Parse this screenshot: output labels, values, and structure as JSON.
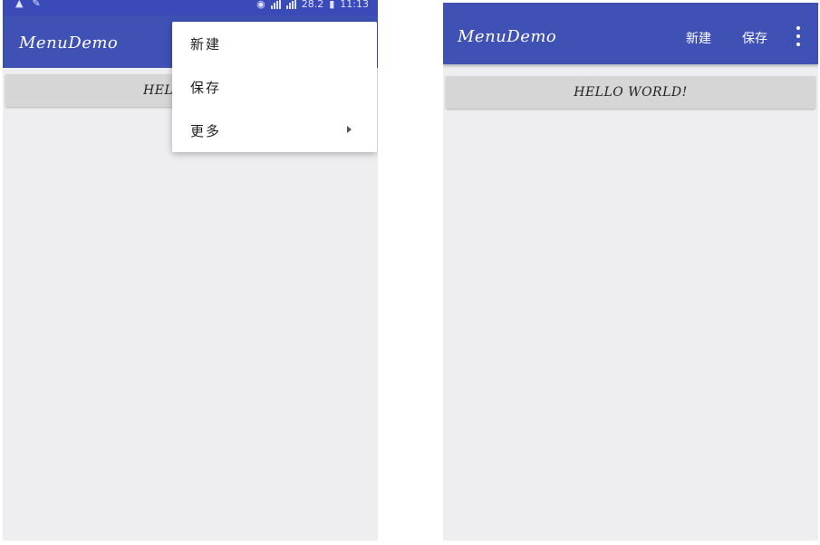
{
  "status_bar": {
    "carrier_label": "28.2",
    "time": "11:13"
  },
  "left_screen": {
    "app_title": "MenuDemo",
    "button_label": "HELLO WORLD!",
    "popup_menu": {
      "items": [
        {
          "label": "新建"
        },
        {
          "label": "保存"
        },
        {
          "label": "更多"
        }
      ]
    }
  },
  "right_screen": {
    "app_title": "MenuDemo",
    "actions": {
      "new_label": "新建",
      "save_label": "保存"
    },
    "button_label": "HELLO WORLD!"
  },
  "colors": {
    "app_bar": "#3f51b5",
    "status_bar": "#3a4ab8",
    "content_bg": "#eeeef0",
    "button_bg": "#d6d6d6"
  }
}
